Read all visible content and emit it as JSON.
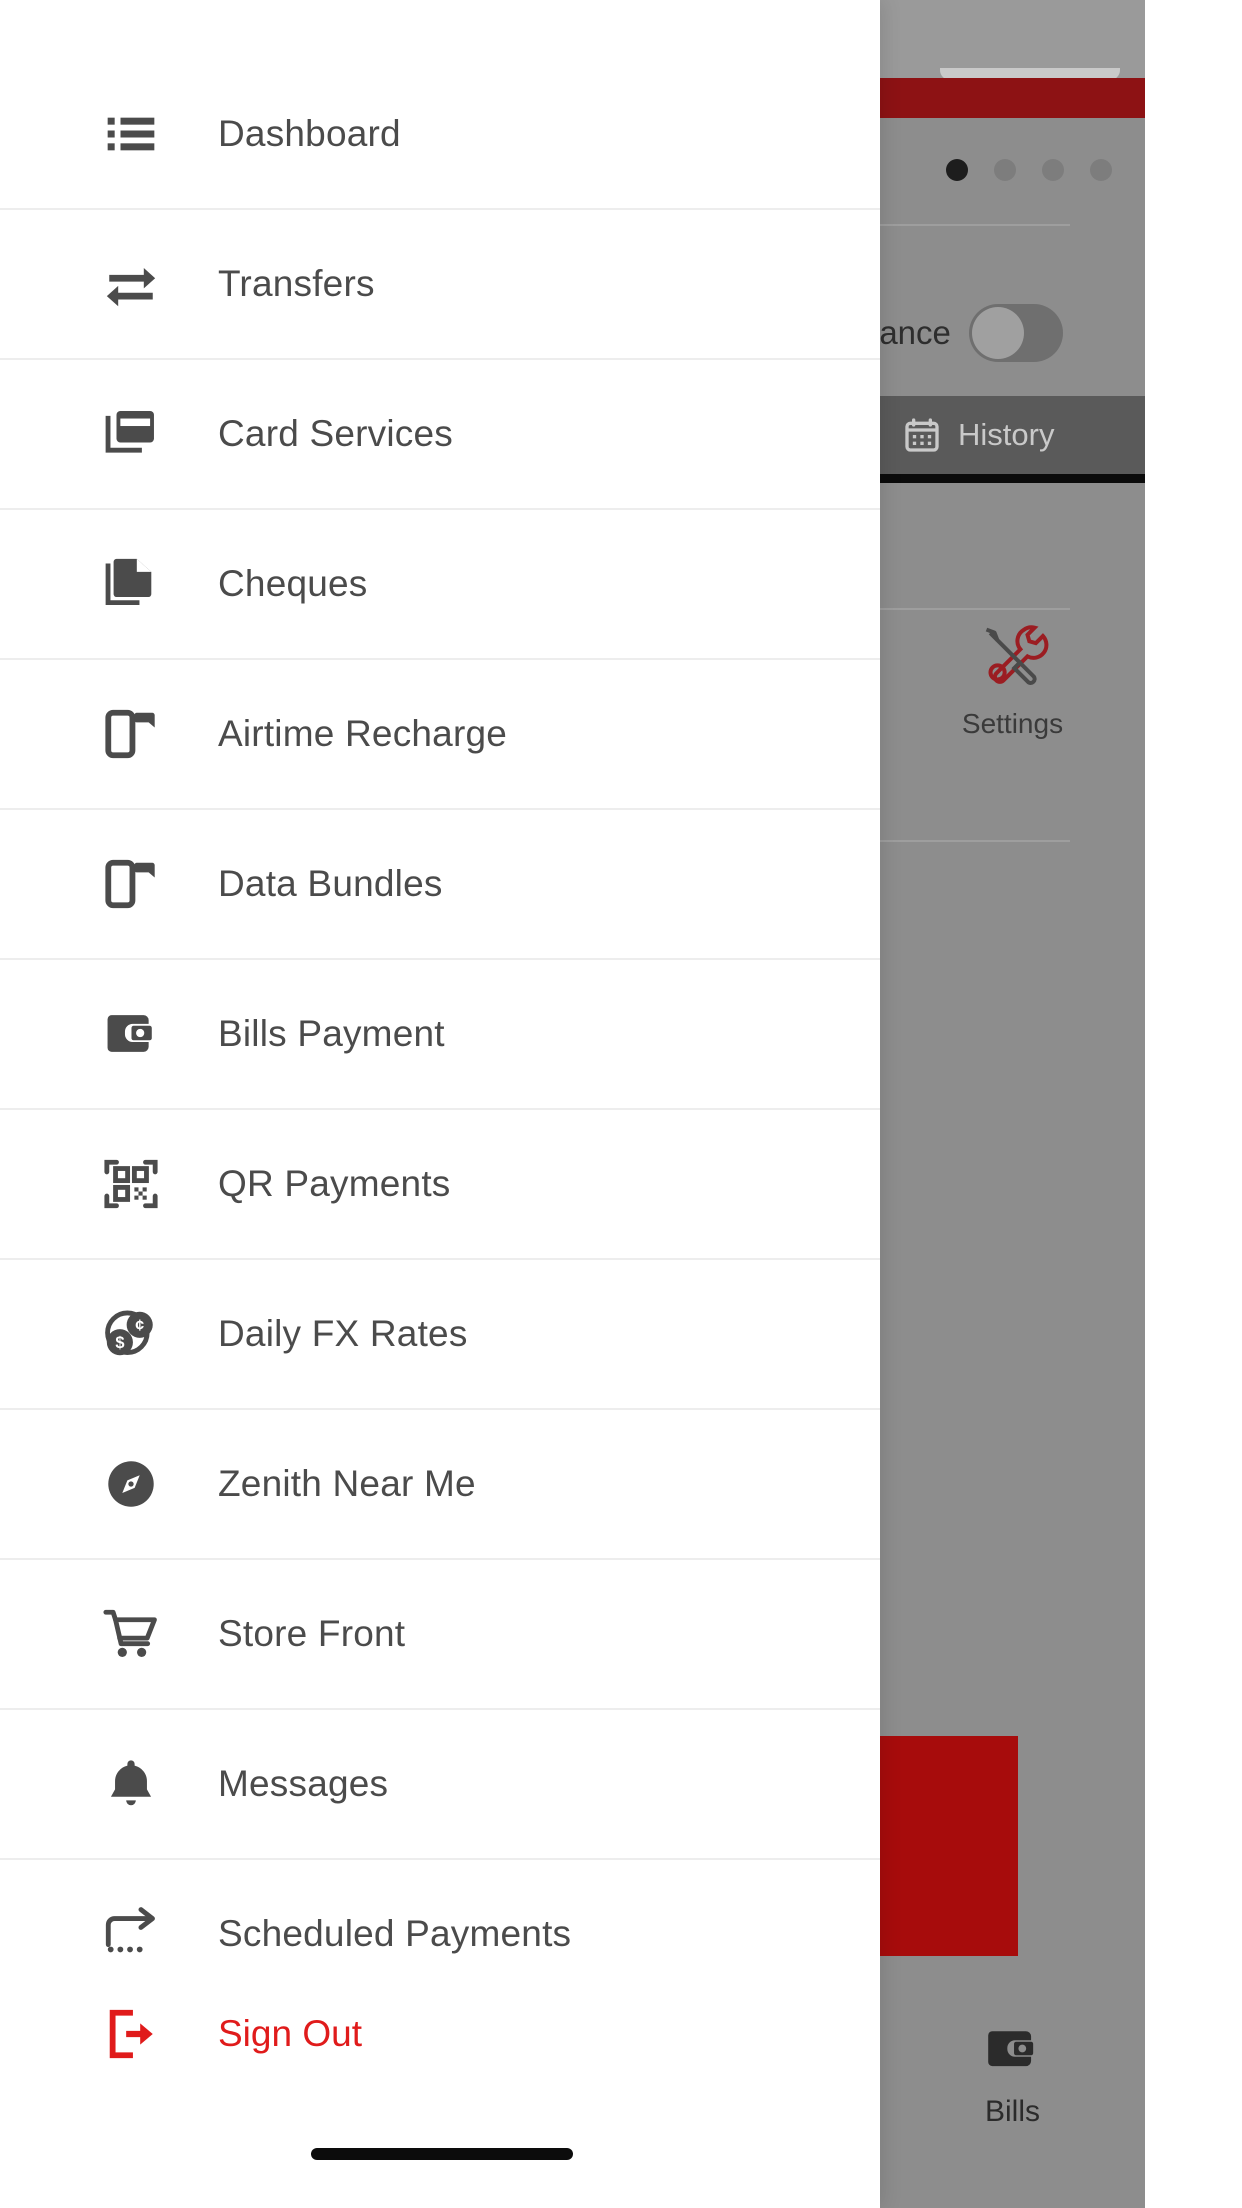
{
  "drawer": {
    "items": [
      {
        "label": "Dashboard",
        "icon": "list-icon"
      },
      {
        "label": "Transfers",
        "icon": "transfer-arrows-icon"
      },
      {
        "label": "Card Services",
        "icon": "credit-card-icon"
      },
      {
        "label": "Cheques",
        "icon": "document-icon"
      },
      {
        "label": "Airtime Recharge",
        "icon": "mobile-phone-icon"
      },
      {
        "label": "Data Bundles",
        "icon": "mobile-phone-icon"
      },
      {
        "label": "Bills Payment",
        "icon": "wallet-icon"
      },
      {
        "label": "QR Payments",
        "icon": "qr-code-icon"
      },
      {
        "label": "Daily FX Rates",
        "icon": "currency-coins-icon"
      },
      {
        "label": "Zenith Near Me",
        "icon": "compass-icon"
      },
      {
        "label": "Store Front",
        "icon": "shopping-cart-icon"
      },
      {
        "label": "Messages",
        "icon": "bell-icon"
      },
      {
        "label": "Scheduled Payments",
        "icon": "scheduled-arrow-icon"
      }
    ],
    "sign_out": {
      "label": "Sign Out",
      "icon": "sign-out-icon",
      "color": "#e01b1b"
    }
  },
  "background_app": {
    "balance_label": "lance",
    "history_tab": {
      "label": "History",
      "icon": "calendar-icon"
    },
    "settings_tile": {
      "label": "Settings",
      "icon": "tools-icon"
    },
    "bills_tab": {
      "label": "Bills",
      "icon": "wallet-icon"
    },
    "carousel": {
      "count": 4,
      "active_index": 0
    },
    "header_color": "#8d1214",
    "promo_color": "#a70c0c"
  }
}
